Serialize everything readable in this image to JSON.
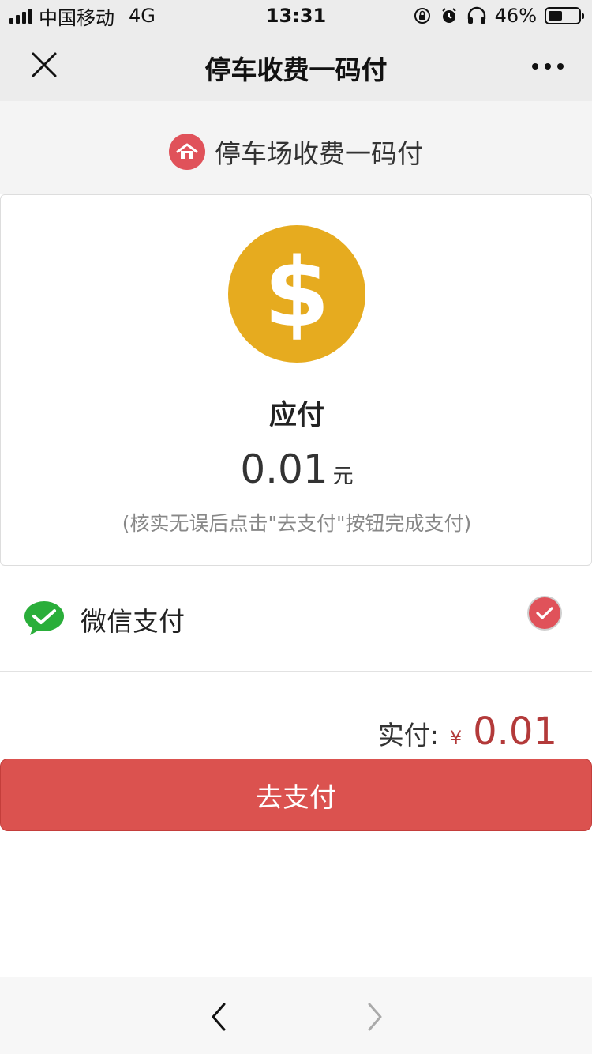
{
  "status": {
    "carrier": "中国移动",
    "network": "4G",
    "time": "13:31",
    "battery_percent_text": "46%",
    "battery_level": 0.46
  },
  "nav": {
    "title": "停车收费一码付",
    "close_icon": "close-icon",
    "more_icon": "more-icon"
  },
  "header": {
    "title": "停车场收费一码付",
    "icon": "home-icon"
  },
  "card": {
    "coin_symbol": "$",
    "due_label": "应付",
    "amount": "0.01",
    "unit": "元",
    "hint": "(核实无误后点击\"去支付\"按钮完成支付)"
  },
  "payment_method": {
    "label": "微信支付",
    "selected": true
  },
  "actual": {
    "label": "实付:",
    "currency": "¥",
    "amount": "0.01"
  },
  "pay_button": {
    "label": "去支付"
  },
  "colors": {
    "accent_red": "#db524f",
    "coin_gold": "#e6ab1f",
    "wechat_green": "#2aae3a",
    "amount_red": "#b33a3a"
  }
}
